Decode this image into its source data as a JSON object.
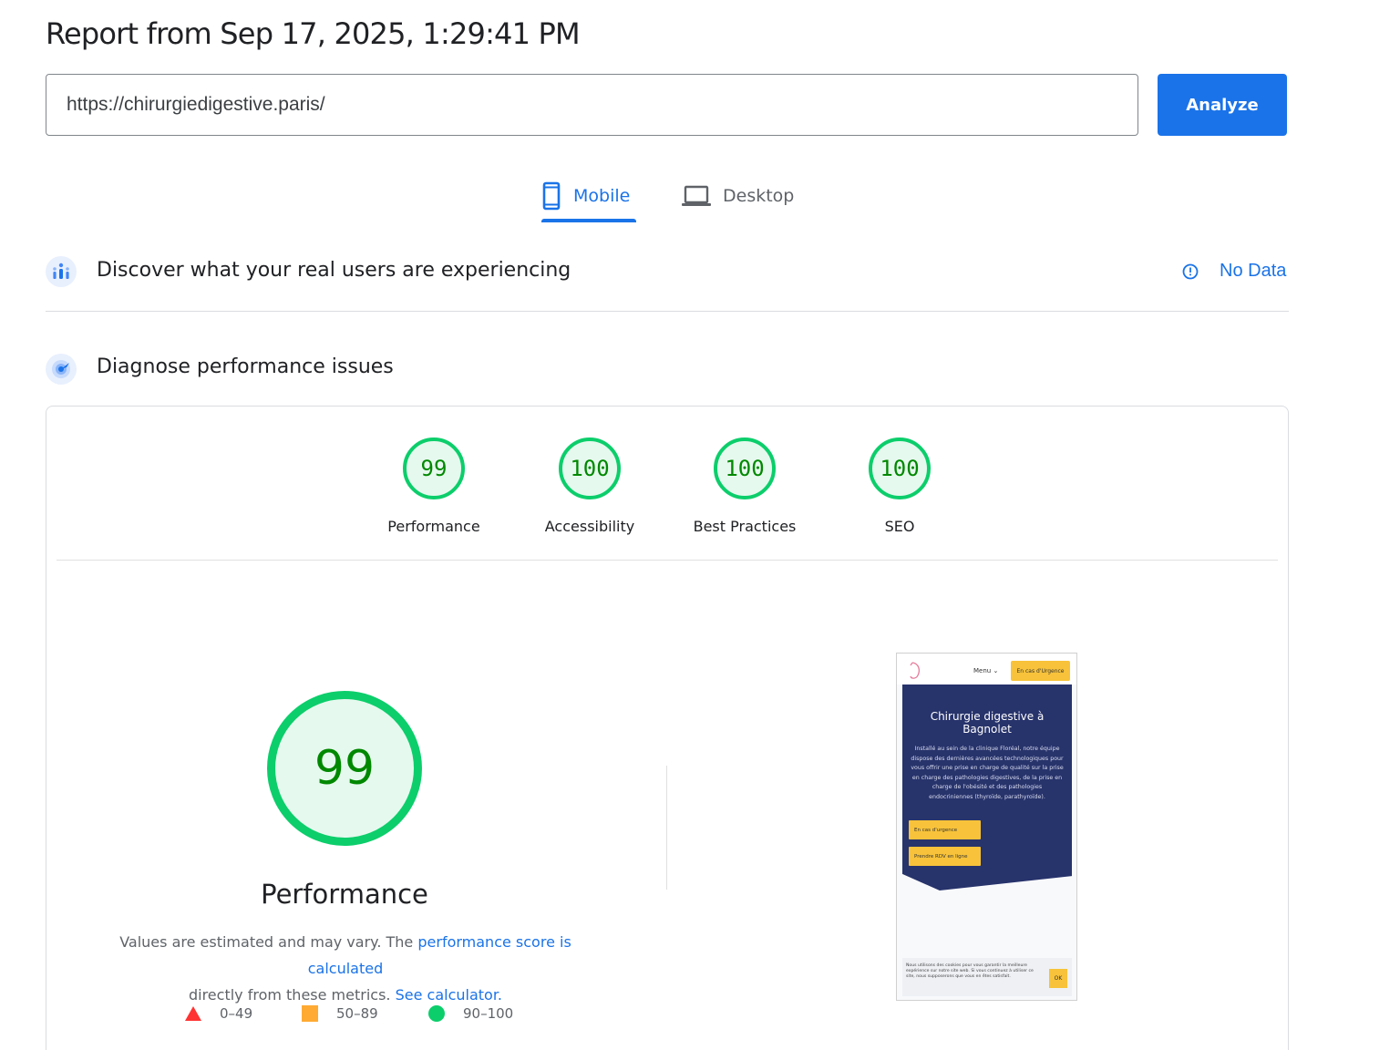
{
  "header": {
    "title": "Report from Sep 17, 2025, 1:29:41 PM"
  },
  "search": {
    "url": "https://chirurgiedigestive.paris/",
    "analyze_label": "Analyze"
  },
  "tabs": [
    {
      "label": "Mobile",
      "icon": "phone-icon",
      "active": true
    },
    {
      "label": "Desktop",
      "icon": "laptop-icon",
      "active": false
    }
  ],
  "field_data": {
    "title": "Discover what your real users are experiencing",
    "status": "No Data",
    "icon": "crux-users-icon"
  },
  "lab_data": {
    "title": "Diagnose performance issues",
    "icon": "lighthouse-icon"
  },
  "scores": [
    {
      "value": "99",
      "label": "Performance"
    },
    {
      "value": "100",
      "label": "Accessibility"
    },
    {
      "value": "100",
      "label": "Best Practices"
    },
    {
      "value": "100",
      "label": "SEO"
    }
  ],
  "score_color": "#0cce6b",
  "performance": {
    "score": "99",
    "label": "Performance",
    "note_1": "Values are estimated and may vary. The ",
    "note_link_1": "performance score is calculated",
    "note_2": " directly from these metrics. ",
    "note_link_2": "See calculator."
  },
  "legend": [
    {
      "range": "0–49",
      "shape": "triangle",
      "color": "#ff3333"
    },
    {
      "range": "50–89",
      "shape": "square",
      "color": "#ffaa33"
    },
    {
      "range": "90–100",
      "shape": "circle",
      "color": "#0cce6b"
    }
  ],
  "screenshot": {
    "menu": "Menu ⌄",
    "urgent_top": "En cas d'Urgence",
    "heading": "Chirurgie digestive à Bagnolet",
    "paragraph": "Installé au sein de la clinique Floréal, notre équipe dispose des dernières avancées technologiques pour vous offrir une prise en charge de qualité sur la prise en charge des pathologies digestives, de la prise en charge de l'obésité et des pathologies endocriniennes (thyroïde, parathyroïde).",
    "button_1": "En cas d'urgence",
    "button_2": "Prendre RDV en ligne",
    "cookie_text": "Nous utilisons des cookies pour vous garantir la meilleure expérience sur notre site web. Si vous continuez à utiliser ce site, nous supposerons que vous en êtes satisfait.",
    "cookie_ok": "OK"
  }
}
